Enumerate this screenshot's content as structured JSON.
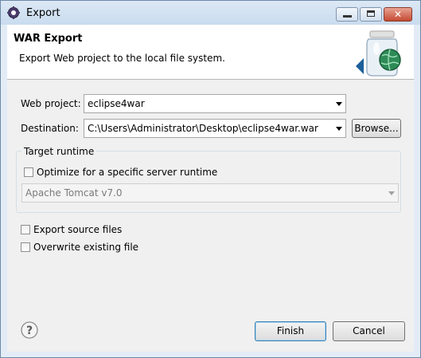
{
  "window": {
    "title": "Export"
  },
  "banner": {
    "title": "WAR Export",
    "description": "Export Web project to the local file system."
  },
  "form": {
    "web_project_label": "Web project:",
    "web_project_value": "eclipse4war",
    "destination_label": "Destination:",
    "destination_value": "C:\\Users\\Administrator\\Desktop\\eclipse4war.war",
    "browse_label": "Browse..."
  },
  "target_runtime": {
    "group_label": "Target runtime",
    "optimize_label": "Optimize for a specific server runtime",
    "optimize_checked": false,
    "runtime_value": "Apache Tomcat v7.0"
  },
  "options": {
    "export_source_label": "Export source files",
    "export_source_checked": false,
    "overwrite_label": "Overwrite existing file",
    "overwrite_checked": false
  },
  "footer": {
    "finish_label": "Finish",
    "cancel_label": "Cancel"
  },
  "icons": {
    "window": "eclipse-gear-icon",
    "banner": "war-jar-globe-icon",
    "help": "help-icon"
  }
}
